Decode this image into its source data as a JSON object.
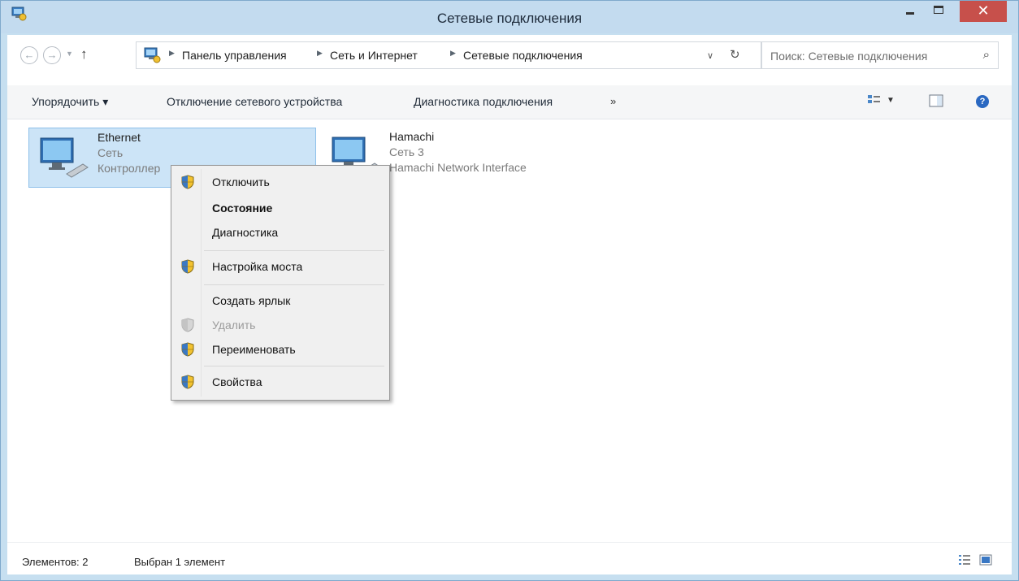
{
  "window": {
    "title": "Сетевые подключения"
  },
  "address": {
    "breadcrumbs": [
      "Панель управления",
      "Сеть и Интернет",
      "Сетевые подключения"
    ],
    "back_icon": "back-arrow-icon",
    "forward_icon": "forward-arrow-icon",
    "up_icon": "up-arrow-icon",
    "refresh_icon": "refresh-icon"
  },
  "search": {
    "placeholder": "Поиск: Сетевые подключения"
  },
  "commands": {
    "organize": "Упорядочить ▾",
    "disable_device": "Отключение сетевого устройства",
    "diagnose": "Диагностика подключения",
    "more": "»"
  },
  "connections": [
    {
      "name": "Ethernet",
      "network": "Сеть",
      "device": "Контроллер",
      "selected": true
    },
    {
      "name": "Hamachi",
      "network": "Сеть 3",
      "device": "Hamachi Network Interface",
      "selected": false
    }
  ],
  "context_menu": {
    "items": [
      {
        "label": "Отключить",
        "shield": true,
        "bold": false,
        "disabled": false
      },
      {
        "label": "Состояние",
        "shield": false,
        "bold": true,
        "disabled": false
      },
      {
        "label": "Диагностика",
        "shield": false,
        "bold": false,
        "disabled": false
      },
      {
        "label": "Настройка моста",
        "shield": true,
        "bold": false,
        "disabled": false
      },
      {
        "label": "Создать ярлык",
        "shield": false,
        "bold": false,
        "disabled": false
      },
      {
        "label": "Удалить",
        "shield": true,
        "bold": false,
        "disabled": true
      },
      {
        "label": "Переименовать",
        "shield": true,
        "bold": false,
        "disabled": false
      },
      {
        "label": "Свойства",
        "shield": true,
        "bold": false,
        "disabled": false
      }
    ]
  },
  "status": {
    "count": "Элементов: 2",
    "selection": "Выбран 1 элемент"
  },
  "colors": {
    "selection": "#cce4f7",
    "selection_border": "#8ec0ea",
    "close_button": "#c7504b",
    "frame": "#c3dbef"
  }
}
